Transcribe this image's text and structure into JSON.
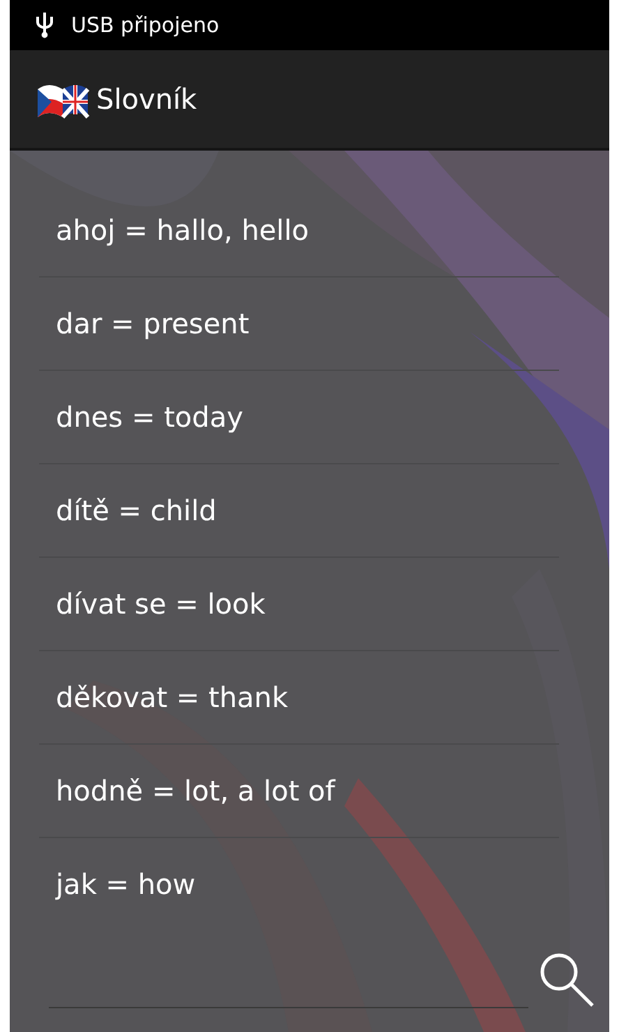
{
  "status_bar": {
    "text": "USB připojeno"
  },
  "action_bar": {
    "title": "Slovník"
  },
  "entries": [
    {
      "text": "ahoj = hallo, hello"
    },
    {
      "text": "dar = present"
    },
    {
      "text": "dnes = today"
    },
    {
      "text": "dítě = child"
    },
    {
      "text": "dívat se = look"
    },
    {
      "text": "děkovat = thank"
    },
    {
      "text": "hodně = lot, a lot of"
    },
    {
      "text": "jak = how"
    }
  ]
}
